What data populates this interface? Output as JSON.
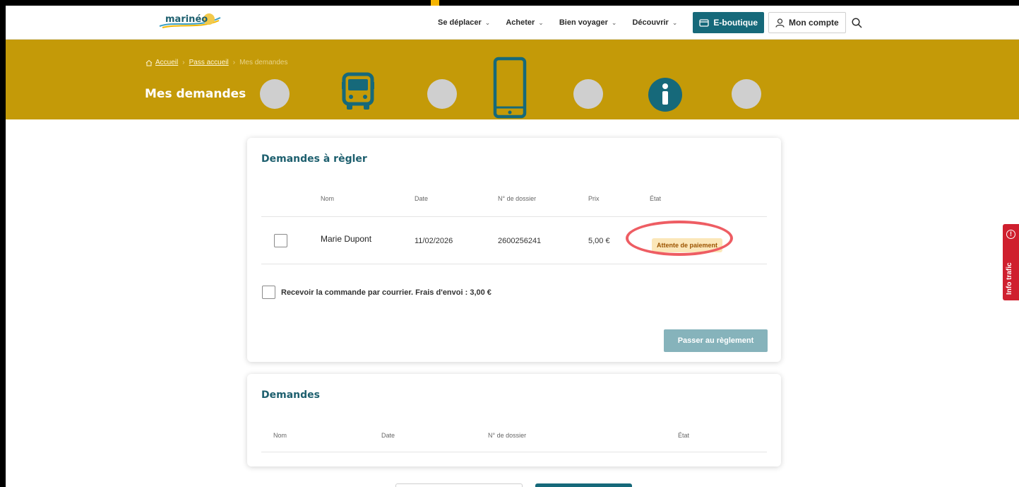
{
  "header": {
    "logo_text": "marinéo",
    "nav": [
      {
        "label": "Se déplacer"
      },
      {
        "label": "Acheter"
      },
      {
        "label": "Bien voyager"
      },
      {
        "label": "Découvrir"
      }
    ],
    "eboutique_label": "E-boutique",
    "account_label": "Mon compte"
  },
  "banner": {
    "breadcrumb": [
      "Accueil",
      "Pass accueil",
      "Mes demandes"
    ],
    "title": "Mes demandes",
    "colors": {
      "banner": "#c49a08",
      "icon_dark": "#16697a",
      "dot": "#cfcfcf"
    }
  },
  "pending": {
    "title": "Demandes à règler",
    "columns": [
      "Nom",
      "Date",
      "N° de dossier",
      "Prix",
      "État"
    ],
    "row": {
      "name": "Marie Dupont",
      "date": "11/02/2026",
      "dossier": "2600256241",
      "price": "5,00 €",
      "status": "Attente de paiement"
    },
    "mail_option": "Recevoir la commande par courrier. Frais d'envoi : 3,00 €",
    "pay_button": "Passer au règlement"
  },
  "requests": {
    "title": "Demandes",
    "columns": [
      "Nom",
      "Date",
      "N° de dossier",
      "État"
    ]
  },
  "side_tab": {
    "label": "Info trafic",
    "color": "#cf1f2e"
  }
}
